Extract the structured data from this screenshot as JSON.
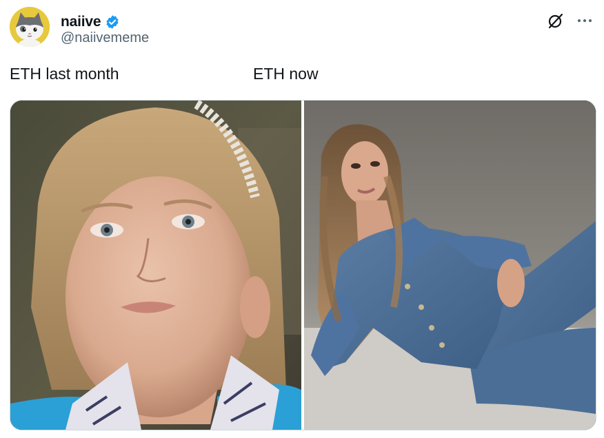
{
  "post": {
    "display_name": "naiive",
    "handle": "@naiivememe",
    "verified": true,
    "caption_left": "ETH last month",
    "caption_right": "ETH now"
  },
  "icons": {
    "verified": "verified-badge-icon",
    "grok": "grok-icon",
    "more": "more-options-icon"
  },
  "colors": {
    "verified_blue": "#1d9bf0",
    "text_primary": "#0f1419",
    "text_secondary": "#536471",
    "avatar_bg": "#e6c93d"
  }
}
